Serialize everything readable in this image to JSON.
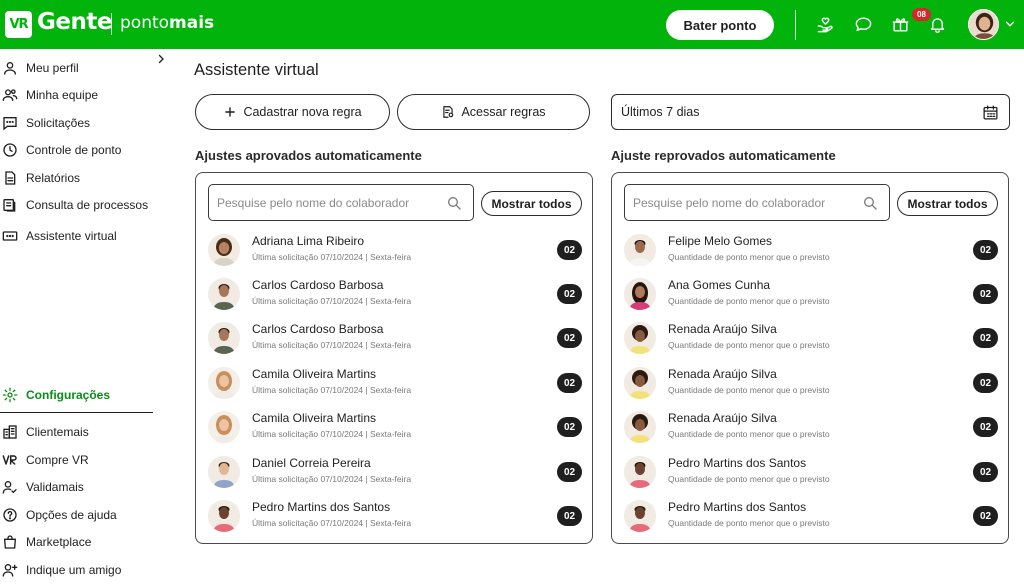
{
  "header": {
    "logo_mark": "VR",
    "brand_gente": "Gente",
    "brand_ponto_regular": "ponto",
    "brand_ponto_bold": "mais",
    "bater_ponto_label": "Bater ponto",
    "notifications_badge": "08",
    "icons": [
      "heart-hand-icon",
      "chat-icon",
      "gift-icon",
      "bell-icon",
      "chevron-down-icon"
    ]
  },
  "sidebar": {
    "items": [
      {
        "label": "Meu perfil",
        "icon": "user-icon"
      },
      {
        "label": "Minha equipe",
        "icon": "team-icon"
      },
      {
        "label": "Solicitações",
        "icon": "message-dots-icon"
      },
      {
        "label": "Controle de ponto",
        "icon": "clock-icon"
      },
      {
        "label": "Relatórios",
        "icon": "document-icon"
      },
      {
        "label": "Consulta de processos",
        "icon": "process-icon"
      },
      {
        "label": "Assistente virtual",
        "icon": "assistant-icon"
      }
    ],
    "config_label": "Configurações",
    "bottom_items": [
      {
        "label": "Clientemais",
        "icon": "building-icon"
      },
      {
        "label": "Compre VR",
        "icon": "vr-icon"
      },
      {
        "label": "Validamais",
        "icon": "user-check-icon"
      },
      {
        "label": "Opções de ajuda",
        "icon": "help-icon"
      },
      {
        "label": "Marketplace",
        "icon": "shopping-bag-icon"
      },
      {
        "label": "Indique um amigo",
        "icon": "user-add-icon"
      }
    ]
  },
  "main": {
    "title": "Assistente virtual",
    "cadastrar_label": "Cadastrar nova regra",
    "acessar_label": "Acessar regras",
    "date_range": "Últimos 7 dias",
    "approved": {
      "title": "Ajustes aprovados automaticamente",
      "search_placeholder": "Pesquise pelo nome do colaborador",
      "show_all_label": "Mostrar todos",
      "rows": [
        {
          "name": "Adriana Lima Ribeiro",
          "sub": "Última solicitação 07/10/2024 | Sexta-feira",
          "count": "02"
        },
        {
          "name": "Carlos Cardoso Barbosa",
          "sub": "Última solicitação 07/10/2024 | Sexta-feira",
          "count": "02"
        },
        {
          "name": "Carlos Cardoso Barbosa",
          "sub": "Última solicitação 07/10/2024 | Sexta-feira",
          "count": "02"
        },
        {
          "name": "Camila Oliveira Martins",
          "sub": "Última solicitação 07/10/2024 | Sexta-feira",
          "count": "02"
        },
        {
          "name": "Camila Oliveira Martins",
          "sub": "Última solicitação 07/10/2024 | Sexta-feira",
          "count": "02"
        },
        {
          "name": "Daniel Correia Pereira",
          "sub": "Última solicitação 07/10/2024 | Sexta-feira",
          "count": "02"
        },
        {
          "name": "Pedro Martins dos Santos",
          "sub": "Última solicitação 07/10/2024 | Sexta-feira",
          "count": "02"
        }
      ]
    },
    "rejected": {
      "title": "Ajuste reprovados automaticamente",
      "search_placeholder": "Pesquise pelo nome do colaborador",
      "show_all_label": "Mostrar todos",
      "rows": [
        {
          "name": "Felipe Melo Gomes",
          "sub": "Quantidade de ponto menor que o previsto",
          "count": "02"
        },
        {
          "name": "Ana Gomes Cunha",
          "sub": "Quantidade de ponto menor que o previsto",
          "count": "02"
        },
        {
          "name": "Renada Araújo Silva",
          "sub": "Quantidade de ponto menor que o previsto",
          "count": "02"
        },
        {
          "name": "Renada Araújo Silva",
          "sub": "Quantidade de ponto menor que o previsto",
          "count": "02"
        },
        {
          "name": "Renada Araújo Silva",
          "sub": "Quantidade de ponto menor que o previsto",
          "count": "02"
        },
        {
          "name": "Pedro Martins dos Santos",
          "sub": "Quantidade de ponto menor que o previsto",
          "count": "02"
        },
        {
          "name": "Pedro Martins dos Santos",
          "sub": "Quantidade de ponto menor que o previsto",
          "count": "02"
        }
      ]
    }
  },
  "colors": {
    "brand_green": "#01b30a",
    "active_green": "#0a8d14",
    "badge_red": "#d62828",
    "count_pill": "#1f1f1f"
  }
}
